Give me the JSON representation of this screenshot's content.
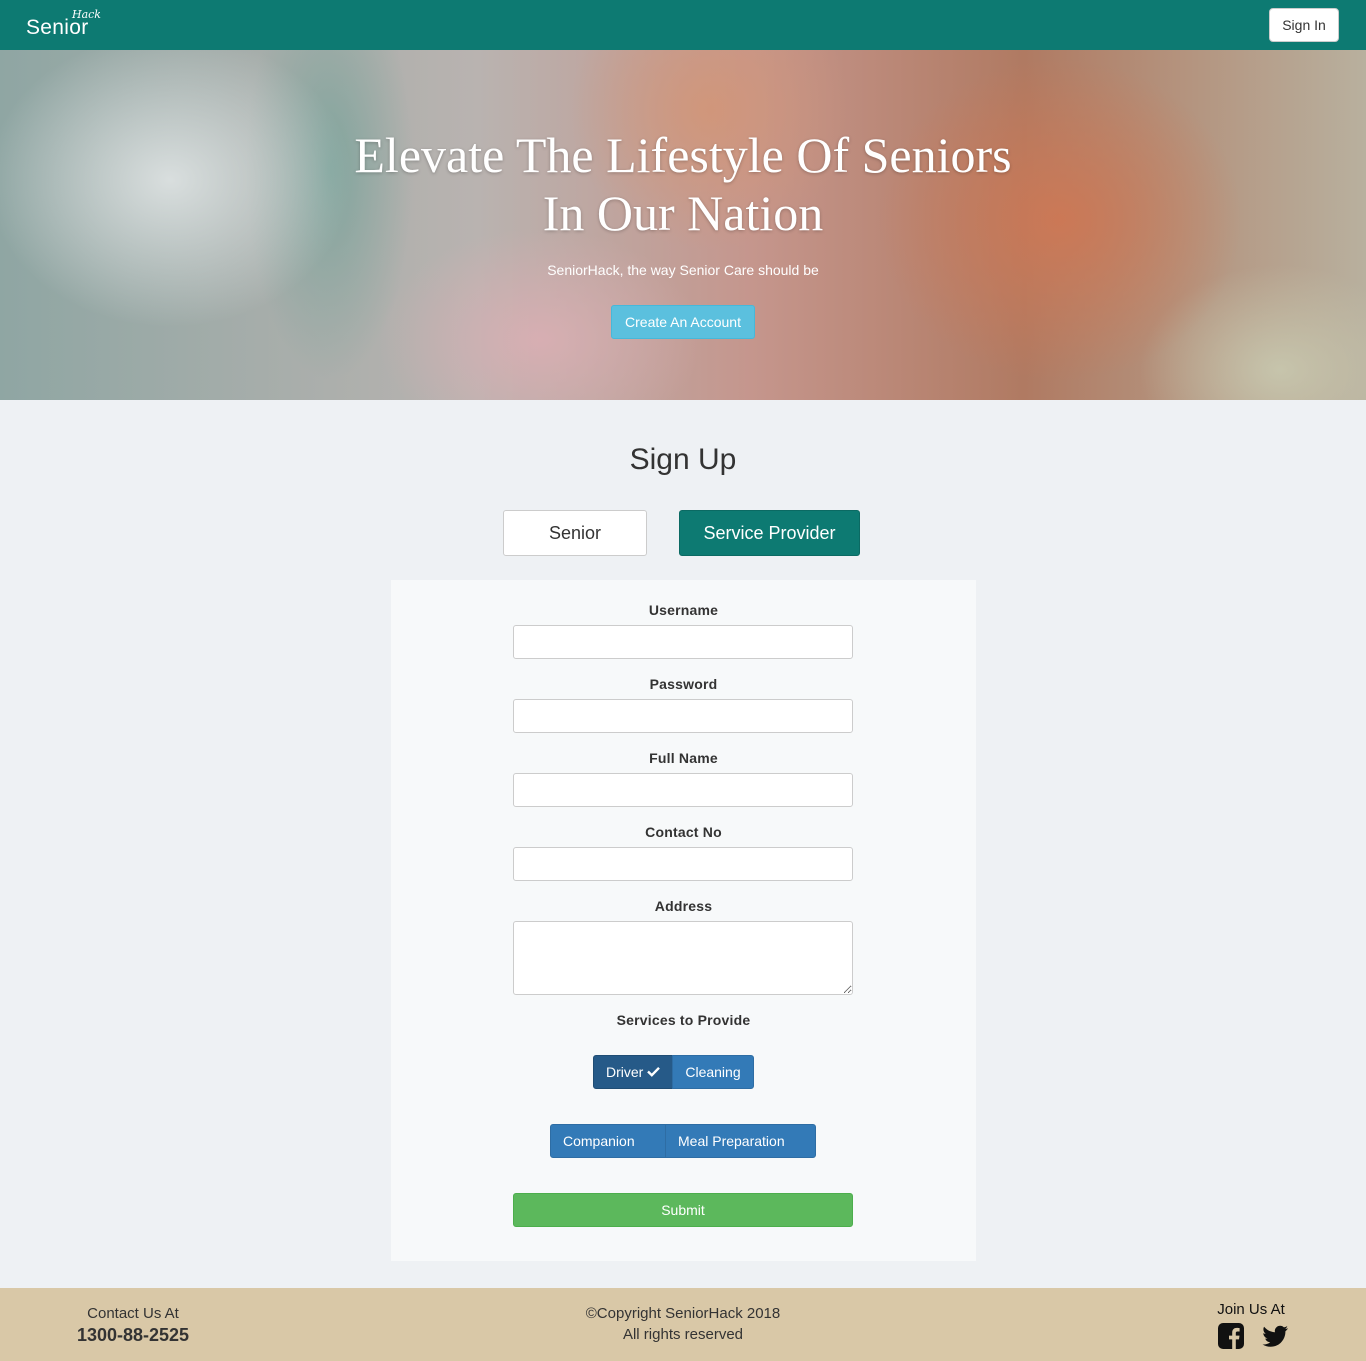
{
  "nav": {
    "brand_main": "Senior",
    "brand_sup": "Hack",
    "signin_label": "Sign In"
  },
  "hero": {
    "title": "Elevate The Lifestyle Of Seniors In Our Nation",
    "subtitle": "SeniorHack, the way Senior Care should be",
    "cta_label": "Create An Account"
  },
  "signup": {
    "title": "Sign Up",
    "types": [
      {
        "label": "Senior",
        "selected": false
      },
      {
        "label": "Service Provider",
        "selected": true
      }
    ],
    "fields": {
      "username": {
        "label": "Username",
        "value": ""
      },
      "password": {
        "label": "Password",
        "value": ""
      },
      "full_name": {
        "label": "Full Name",
        "value": ""
      },
      "contact_no": {
        "label": "Contact No",
        "value": ""
      },
      "address": {
        "label": "Address",
        "value": ""
      }
    },
    "services": {
      "label": "Services to Provide",
      "options": [
        {
          "label": "Driver",
          "selected": true
        },
        {
          "label": "Cleaning",
          "selected": false
        },
        {
          "label": "Companion",
          "selected": false
        },
        {
          "label": "Meal Preparation",
          "selected": false
        }
      ]
    },
    "submit_label": "Submit"
  },
  "footer": {
    "contact_label": "Contact Us At",
    "phone": "1300-88-2525",
    "copyright": "©Copyright SeniorHack 2018",
    "rights": "All rights reserved",
    "join_label": "Join Us At",
    "social_icons": [
      "facebook-icon",
      "twitter-icon"
    ]
  },
  "colors": {
    "brand_teal": "#0d7a72",
    "cta_blue": "#5bc0de",
    "service_blue": "#337ab7",
    "submit_green": "#5cb85c",
    "footer_bg": "#d9c8a7"
  }
}
